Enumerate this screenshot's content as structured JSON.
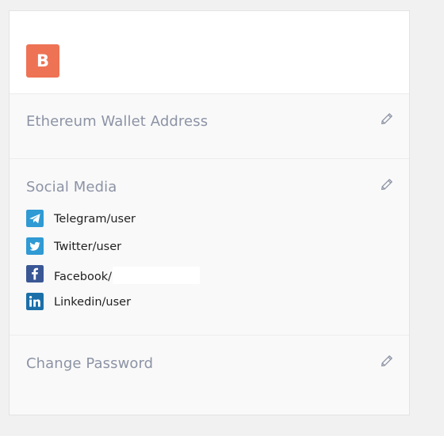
{
  "profile": {
    "avatar_letter": "B",
    "avatar_color": "#ee7355"
  },
  "sections": {
    "wallet": {
      "title": "Ethereum Wallet Address"
    },
    "social": {
      "title": "Social Media",
      "items": [
        {
          "network": "telegram",
          "text": "Telegram/user",
          "icon": "telegram-icon",
          "color": "#2f9ad4"
        },
        {
          "network": "twitter",
          "text": "Twitter/user",
          "icon": "twitter-icon",
          "color": "#2f9ad4"
        },
        {
          "network": "facebook",
          "text": "Facebook/",
          "icon": "facebook-icon",
          "color": "#3a5795"
        },
        {
          "network": "linkedin",
          "text": "Linkedin/user",
          "icon": "linkedin-icon",
          "color": "#1b6fa9"
        }
      ]
    },
    "password": {
      "title": "Change Password"
    }
  },
  "icons": {
    "edit": "pencil-icon"
  }
}
